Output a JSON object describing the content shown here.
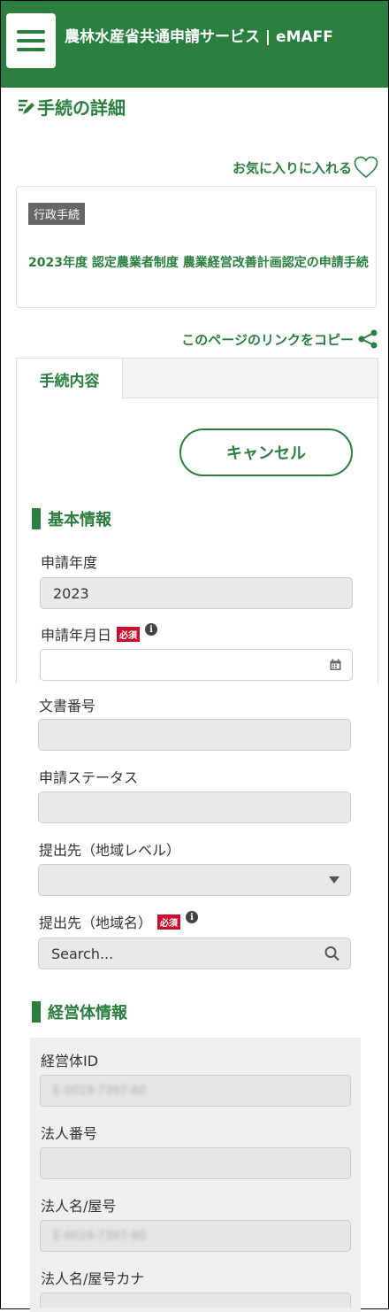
{
  "header": {
    "title": "農林水産省共通申請サービス | eMAFF"
  },
  "page": {
    "title": "手続の詳細",
    "favorite_label": "お気に入りに入れる",
    "copy_link_label": "このページのリンクをコピー"
  },
  "procedure": {
    "category_badge": "行政手続",
    "name": "2023年度 認定農業者制度 農業経営改善計画認定の申請手続"
  },
  "tabs": [
    {
      "label": "手続内容"
    }
  ],
  "actions": {
    "cancel_label": "キャンセル"
  },
  "required_badge": "必須",
  "basic_info": {
    "heading": "基本情報",
    "fields": {
      "fiscal_year": {
        "label": "申請年度",
        "value": "2023"
      },
      "application_date": {
        "label": "申請年月日",
        "value": ""
      },
      "document_number": {
        "label": "文書番号",
        "value": ""
      },
      "status": {
        "label": "申請ステータス",
        "value": ""
      },
      "submit_region_level": {
        "label": "提出先（地域レベル）",
        "value": ""
      },
      "submit_region_name": {
        "label": "提出先（地域名）",
        "placeholder": "Search..."
      }
    }
  },
  "entity_info": {
    "heading": "経営体情報",
    "fields": {
      "entity_id": {
        "label": "経営体ID",
        "value": "E-0019-7397-60"
      },
      "corporate_number": {
        "label": "法人番号",
        "value": ""
      },
      "corporate_name": {
        "label": "法人名/屋号",
        "value": "E-0019-7397-60"
      },
      "corporate_name_kana": {
        "label": "法人名/屋号カナ",
        "value": ""
      }
    }
  },
  "colors": {
    "brand": "#2a7f3f",
    "required": "#c8102e"
  }
}
